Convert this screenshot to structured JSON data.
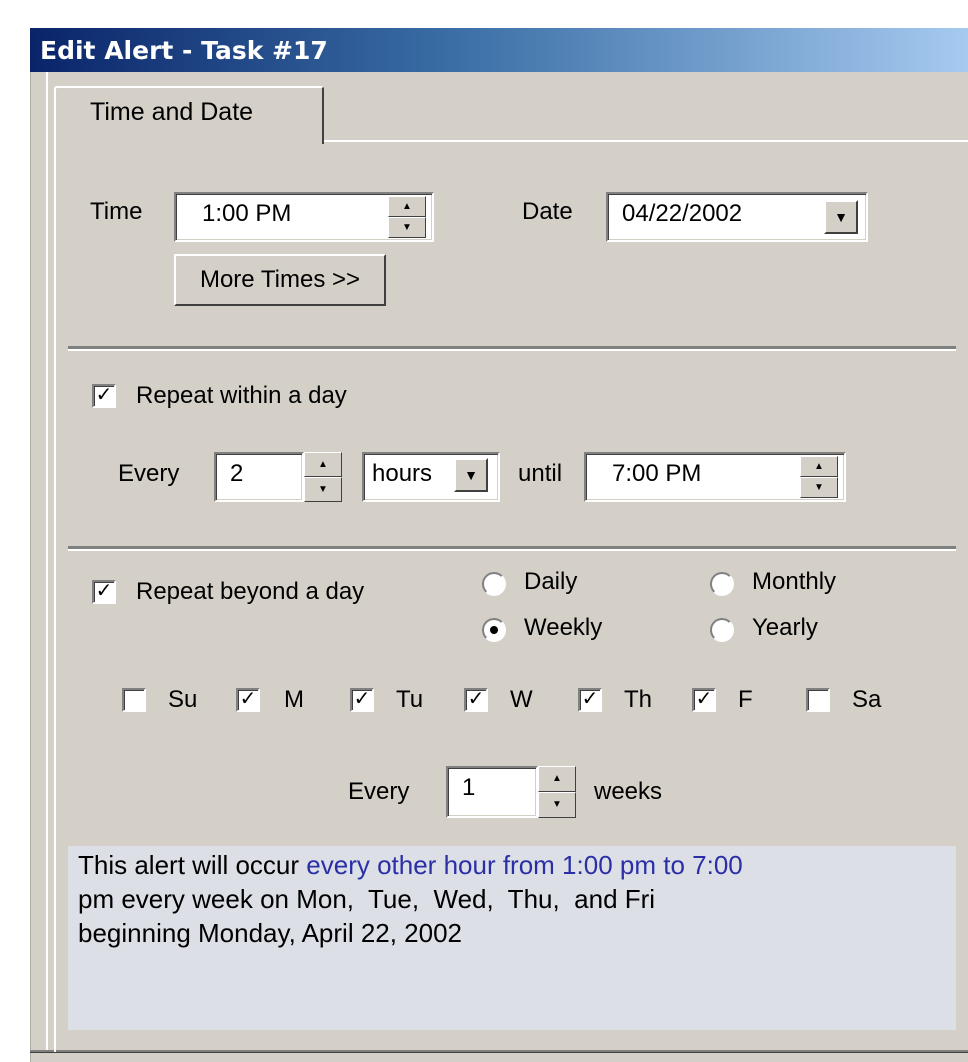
{
  "window": {
    "title": "Edit Alert - Task #17"
  },
  "tabs": [
    {
      "label": "Time and Date",
      "active": true
    }
  ],
  "time_section": {
    "time_label": "Time",
    "time_value": "1:00 PM",
    "date_label": "Date",
    "date_value": "04/22/2002",
    "more_times_button": "More Times >>"
  },
  "repeat_within": {
    "checkbox_label": "Repeat within a day",
    "checked": true,
    "every_label": "Every",
    "interval_value": "2",
    "unit_value": "hours",
    "until_label": "until",
    "until_value": "7:00 PM"
  },
  "repeat_beyond": {
    "checkbox_label": "Repeat beyond a day",
    "checked": true,
    "options": [
      {
        "label": "Daily",
        "selected": false
      },
      {
        "label": "Monthly",
        "selected": false
      },
      {
        "label": "Weekly",
        "selected": true
      },
      {
        "label": "Yearly",
        "selected": false
      }
    ],
    "days": [
      {
        "label": "Su",
        "checked": false
      },
      {
        "label": "M",
        "checked": true
      },
      {
        "label": "Tu",
        "checked": true
      },
      {
        "label": "W",
        "checked": true
      },
      {
        "label": "Th",
        "checked": true
      },
      {
        "label": "F",
        "checked": true
      },
      {
        "label": "Sa",
        "checked": false
      }
    ],
    "every_label": "Every",
    "weeks_value": "1",
    "weeks_label": "weeks"
  },
  "summary": {
    "prefix": "This alert will occur ",
    "highlight": "every other hour from 1:00 pm to 7:00",
    "line2": "pm every week on Mon,  Tue,  Wed,  Thu,  and Fri",
    "line3": "beginning Monday, April 22, 2002"
  },
  "colors": {
    "title_bar_start": "#0a246a",
    "title_bar_end": "#a6caf0",
    "dialog_face": "#d4d0c8",
    "summary_bg": "#dcdfe6",
    "summary_highlight": "#2b2fa6"
  }
}
